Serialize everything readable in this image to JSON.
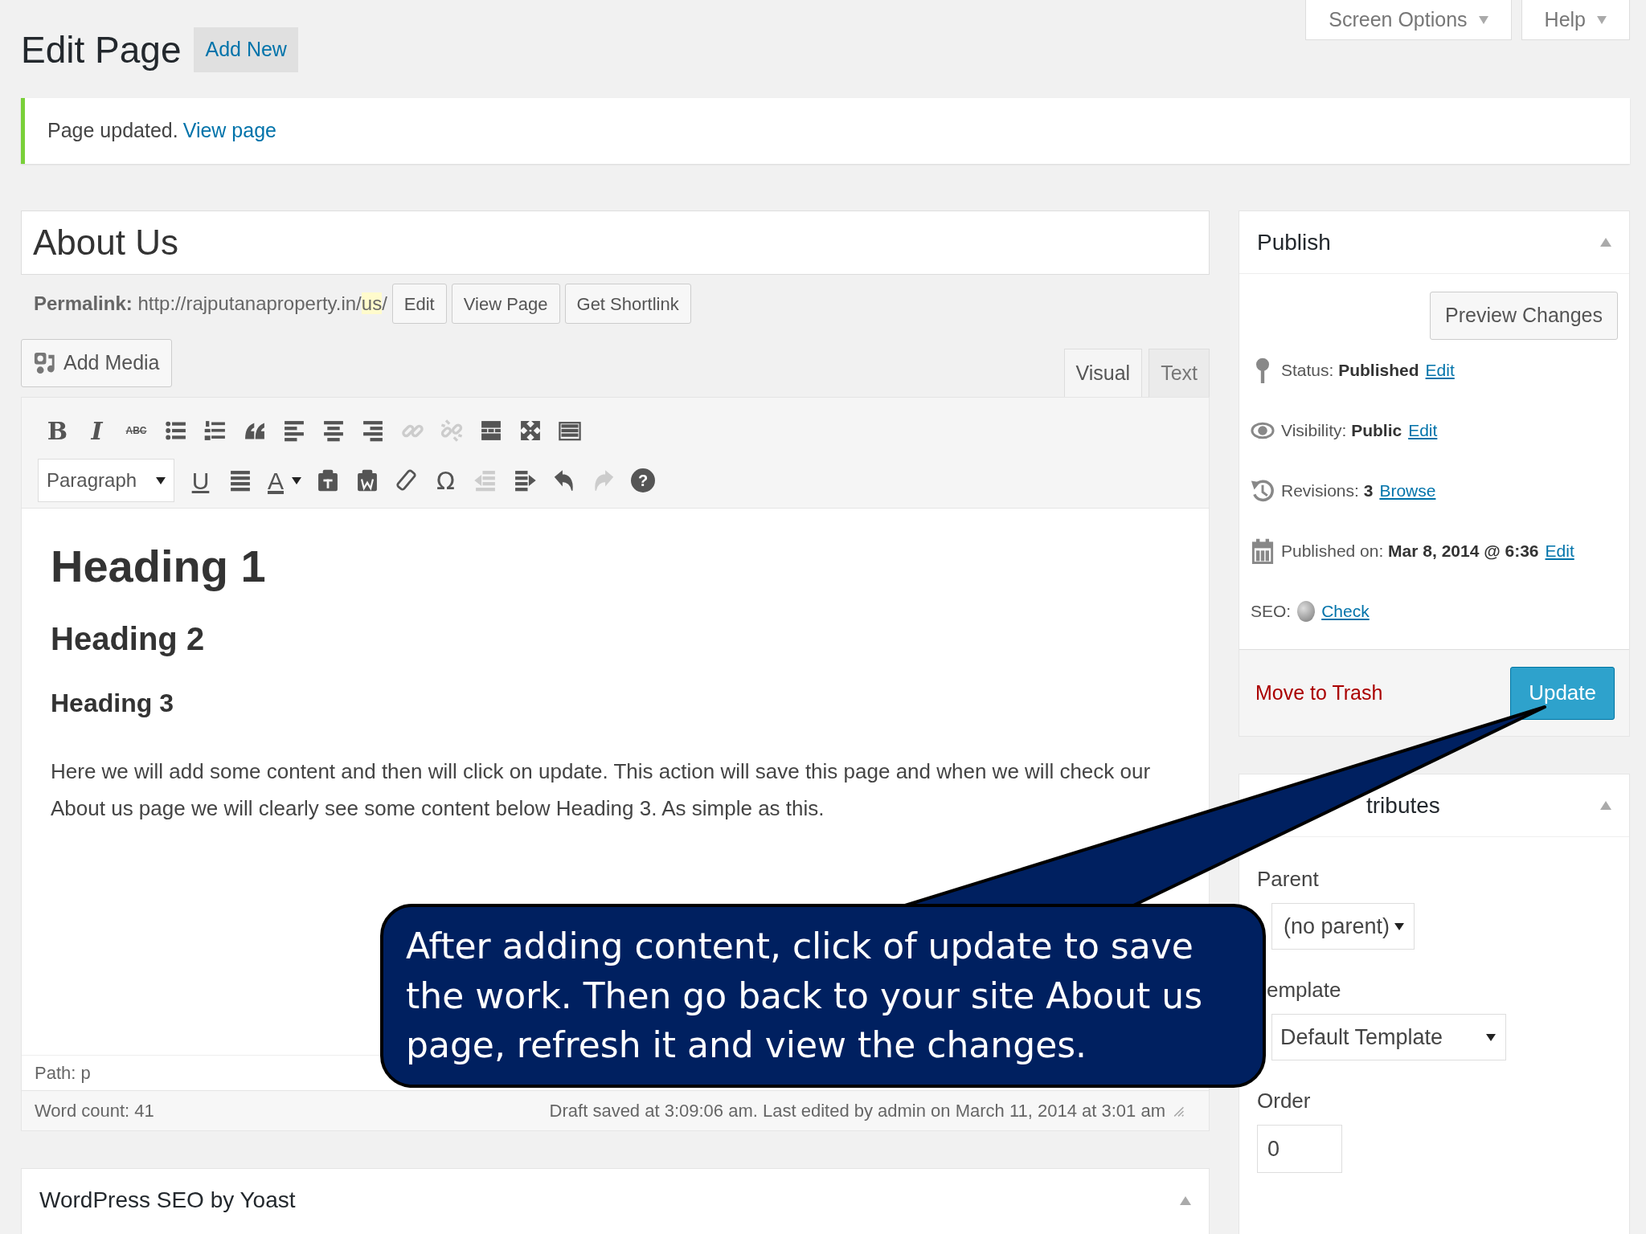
{
  "header": {
    "title": "Edit Page",
    "add_new": "Add New"
  },
  "screen_tabs": [
    {
      "label": "Screen Options"
    },
    {
      "label": "Help"
    }
  ],
  "notice": {
    "text": "Page updated.",
    "link": "View page"
  },
  "post_title": "About Us",
  "permalink": {
    "label": "Permalink:",
    "url": "http://rajputanaproperty.in/",
    "slug": "us",
    "trail": "/",
    "buttons": [
      "Edit",
      "View Page",
      "Get Shortlink"
    ]
  },
  "add_media": "Add Media",
  "editor_tabs": [
    {
      "label": "Visual",
      "selected": true
    },
    {
      "label": "Text",
      "selected": false
    }
  ],
  "toolbar_rows": [
    [
      {
        "kind": "bold",
        "glyph": "B",
        "disabled": false
      },
      {
        "kind": "italic",
        "glyph": "I",
        "disabled": false
      },
      {
        "kind": "strike",
        "glyph": "ABC",
        "disabled": false
      },
      {
        "kind": "ul",
        "disabled": false
      },
      {
        "kind": "ol",
        "disabled": false
      },
      {
        "kind": "quote",
        "disabled": false
      },
      {
        "kind": "align-left",
        "disabled": false
      },
      {
        "kind": "align-center",
        "disabled": false
      },
      {
        "kind": "align-right",
        "disabled": false
      },
      {
        "kind": "link",
        "disabled": true
      },
      {
        "kind": "unlink",
        "disabled": true
      },
      {
        "kind": "more",
        "disabled": false
      },
      {
        "kind": "fullscreen",
        "disabled": false
      },
      {
        "kind": "kitchen-sink",
        "disabled": false
      }
    ],
    [
      {
        "kind": "select",
        "value": "Paragraph"
      },
      {
        "kind": "underline",
        "glyph": "U",
        "disabled": false
      },
      {
        "kind": "justify",
        "disabled": false
      },
      {
        "kind": "text-color",
        "glyph": "A",
        "disabled": false
      },
      {
        "kind": "paste-text",
        "disabled": false
      },
      {
        "kind": "paste-word",
        "disabled": false
      },
      {
        "kind": "eraser",
        "disabled": false
      },
      {
        "kind": "omega",
        "glyph": "Ω",
        "disabled": false
      },
      {
        "kind": "outdent",
        "disabled": true
      },
      {
        "kind": "indent",
        "disabled": false
      },
      {
        "kind": "undo",
        "disabled": false
      },
      {
        "kind": "redo",
        "disabled": true
      },
      {
        "kind": "help",
        "glyph": "?",
        "disabled": false
      }
    ]
  ],
  "content": [
    {
      "kind": "h1",
      "text": "Heading 1"
    },
    {
      "kind": "h2",
      "text": "Heading 2"
    },
    {
      "kind": "h3",
      "text": "Heading 3"
    },
    {
      "kind": "p",
      "text": "Here we will add some content and then will click on update. This action will save this page and when we will check our About us page we will clearly see some content below Heading 3. As simple as this."
    }
  ],
  "path": "Path: p",
  "word_count": "Word count: 41",
  "autosave": "Draft saved at 3:09:06 am. Last edited by admin on March 11, 2014 at 3:01 am",
  "yoast": {
    "title": "WordPress SEO by Yoast"
  },
  "publish": {
    "title": "Publish",
    "preview": "Preview Changes",
    "rows": [
      {
        "kind": "status",
        "label": "Status:",
        "value": "Published",
        "link": "Edit"
      },
      {
        "kind": "visibility",
        "label": "Visibility:",
        "value": "Public",
        "link": "Edit"
      },
      {
        "kind": "revisions",
        "label": "Revisions:",
        "value": "3",
        "link": "Browse"
      },
      {
        "kind": "date",
        "label": "Published on:",
        "value": "Mar 8, 2014 @ 6:36",
        "link": "Edit"
      },
      {
        "kind": "seo",
        "label": "SEO:",
        "link": "Check"
      }
    ],
    "trash": "Move to Trash",
    "update": "Update"
  },
  "attributes": {
    "title": "tributes",
    "fields": [
      {
        "kind": "select",
        "label": "Parent",
        "value": "(no parent)"
      },
      {
        "kind": "select",
        "label": "emplate",
        "value": "Default Template"
      },
      {
        "kind": "input",
        "label": "Order",
        "value": "0"
      }
    ]
  },
  "callout": {
    "text": "After adding content, click of update to save the work. Then go back to your site About us page, refresh it and view the changes."
  }
}
